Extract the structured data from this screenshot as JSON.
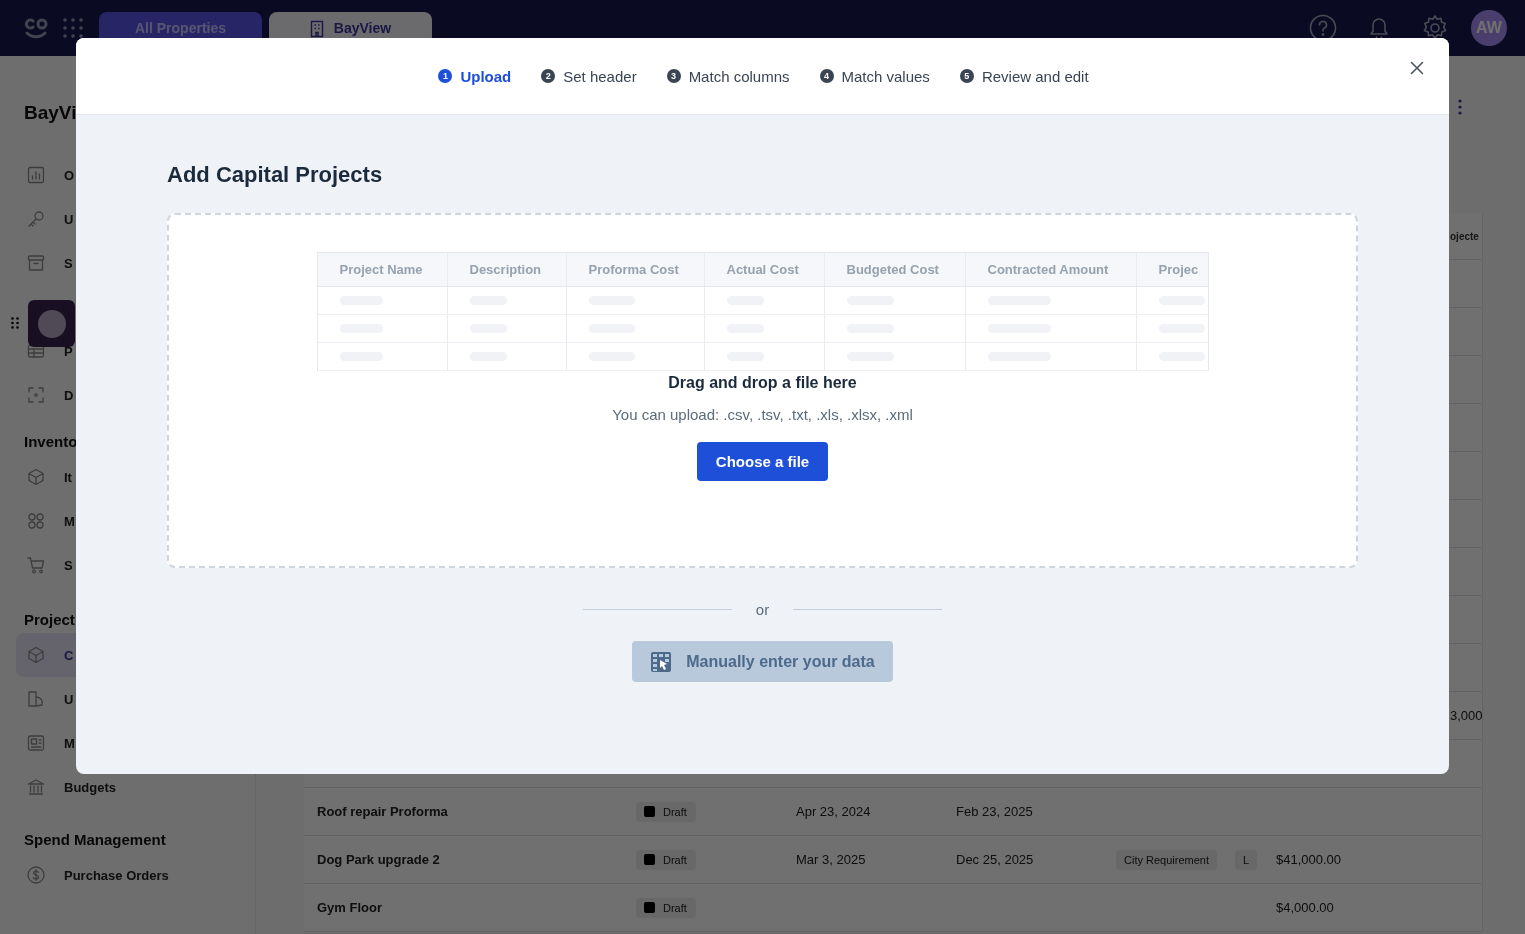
{
  "top_bar": {
    "tabs": [
      {
        "label": "All Properties",
        "selected": false
      },
      {
        "label": "BayView",
        "selected": true
      }
    ],
    "avatar": "AW"
  },
  "sidebar": {
    "title": "BayVi",
    "sections": [
      {
        "items": [
          {
            "label": "O",
            "selected": false
          },
          {
            "label": "U",
            "selected": false
          },
          {
            "label": "S",
            "selected": false
          },
          {
            "label": "P",
            "selected": false
          },
          {
            "label": "D",
            "selected": false
          }
        ]
      },
      {
        "heading": "Invento",
        "items": [
          {
            "label": "It",
            "selected": false
          },
          {
            "label": "M",
            "selected": false
          },
          {
            "label": "S",
            "selected": false
          }
        ]
      },
      {
        "heading": "Project",
        "items": [
          {
            "label": "C",
            "selected": true
          },
          {
            "label": "U",
            "selected": false
          },
          {
            "label": "M",
            "selected": false
          },
          {
            "label": "Budgets",
            "selected": false
          }
        ]
      },
      {
        "heading": "Spend Management",
        "items": [
          {
            "label": "Purchase Orders",
            "selected": false
          }
        ]
      }
    ]
  },
  "projects_table": {
    "header_fragment": "ojecte",
    "partial_cell": "3,000",
    "rows": [
      {
        "name": "Roof repair Proforma",
        "status": "Draft",
        "start": "Apr 23, 2024",
        "end": "Feb 23, 2025"
      },
      {
        "name": "Dog Park upgrade 2",
        "status": "Draft",
        "start": "Mar 3, 2025",
        "end": "Dec 25, 2025",
        "tags": [
          "City Requirement",
          "L"
        ],
        "amount": "$41,000.00"
      },
      {
        "name": "Gym Floor",
        "status": "Draft",
        "amount": "$4,000.00"
      }
    ]
  },
  "import_dialog": {
    "steps": [
      {
        "number": "1",
        "label": "Upload",
        "selected": true
      },
      {
        "number": "2",
        "label": "Set header",
        "selected": false
      },
      {
        "number": "3",
        "label": "Match columns",
        "selected": false
      },
      {
        "number": "4",
        "label": "Match values",
        "selected": false
      },
      {
        "number": "5",
        "label": "Review and edit",
        "selected": false
      }
    ],
    "title": "Add Capital Projects",
    "preview_columns": [
      "Project Name",
      "Description",
      "Proforma Cost",
      "Actual Cost",
      "Budgeted Cost",
      "Contracted Amount",
      "Projec"
    ],
    "drop_title": "Drag and drop a file here",
    "drop_hint": "You can upload: .csv, .tsv, .txt, .xls, .xlsx, .xml",
    "choose_button": "Choose a file",
    "or_label": "or",
    "manual_button": "Manually enter your data"
  }
}
